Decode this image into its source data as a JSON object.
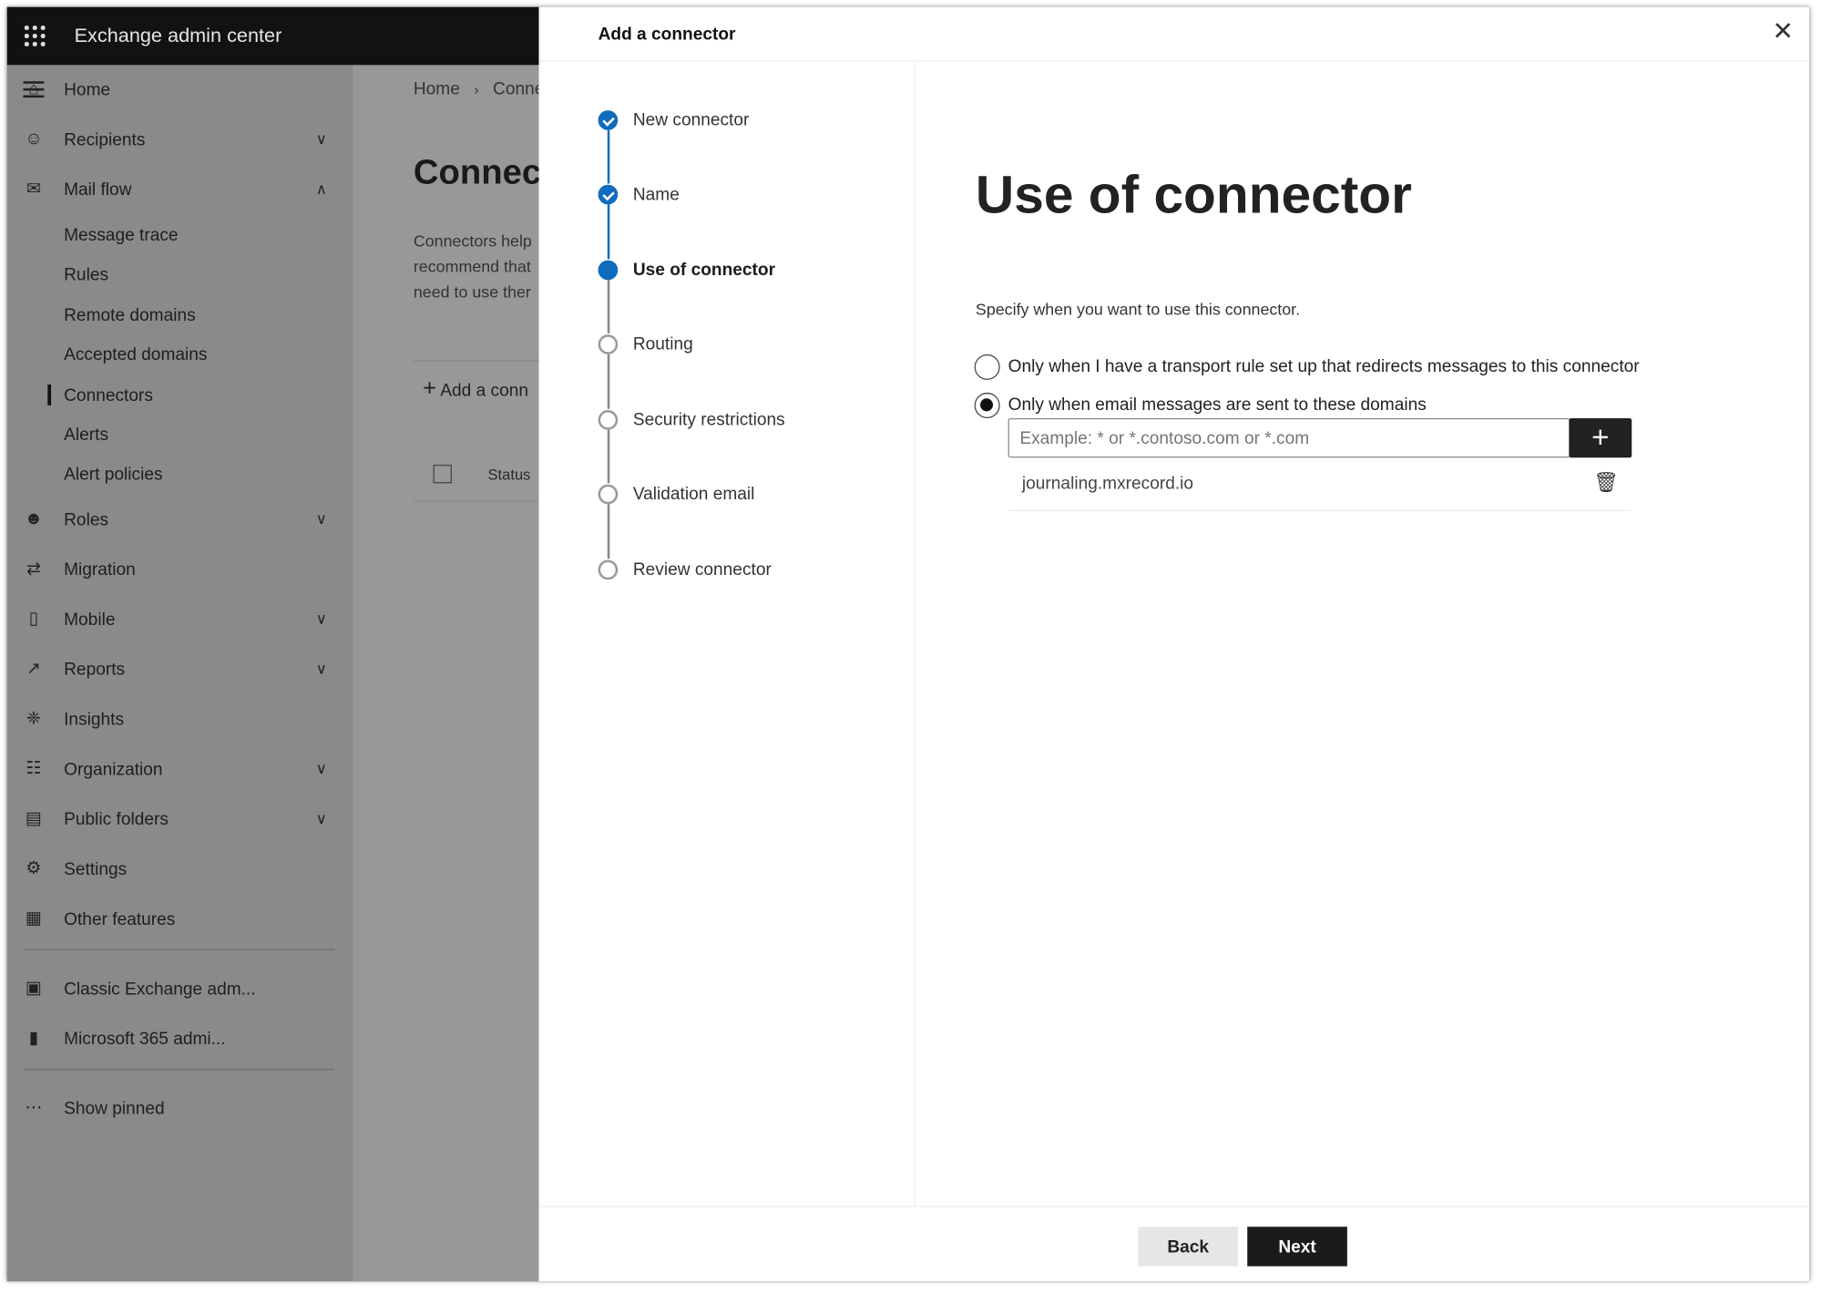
{
  "app": {
    "title": "Exchange admin center"
  },
  "sidebar": {
    "items": [
      {
        "label": "Home",
        "icon": "home-icon",
        "chevron": ""
      },
      {
        "label": "Recipients",
        "icon": "person-icon",
        "chevron": "down"
      },
      {
        "label": "Mail flow",
        "icon": "mail-icon",
        "chevron": "up"
      },
      {
        "label": "Message trace",
        "sub": true
      },
      {
        "label": "Rules",
        "sub": true
      },
      {
        "label": "Remote domains",
        "sub": true
      },
      {
        "label": "Accepted domains",
        "sub": true
      },
      {
        "label": "Connectors",
        "sub": true,
        "selected": true
      },
      {
        "label": "Alerts",
        "sub": true
      },
      {
        "label": "Alert policies",
        "sub": true
      },
      {
        "label": "Roles",
        "icon": "roles-icon",
        "chevron": "down"
      },
      {
        "label": "Migration",
        "icon": "migration-icon",
        "chevron": ""
      },
      {
        "label": "Mobile",
        "icon": "mobile-icon",
        "chevron": "down"
      },
      {
        "label": "Reports",
        "icon": "chart-icon",
        "chevron": "down"
      },
      {
        "label": "Insights",
        "icon": "lightbulb-icon",
        "chevron": ""
      },
      {
        "label": "Organization",
        "icon": "org-icon",
        "chevron": "down"
      },
      {
        "label": "Public folders",
        "icon": "folder-icon",
        "chevron": "down"
      },
      {
        "label": "Settings",
        "icon": "gear-icon",
        "chevron": ""
      },
      {
        "label": "Other features",
        "icon": "grid-icon",
        "chevron": ""
      }
    ],
    "pinned": [
      {
        "label": "Classic Exchange adm...",
        "icon": "exchange-icon"
      },
      {
        "label": "Microsoft 365 admi...",
        "icon": "office-icon"
      }
    ],
    "show_pinned": "Show pinned"
  },
  "background_page": {
    "breadcrumb": [
      "Home",
      "Conne"
    ],
    "title": "Connec",
    "desc": [
      "Connectors help",
      "recommend that",
      "need to use ther"
    ],
    "add_button": "Add a conn",
    "column_status": "Status"
  },
  "panel": {
    "title": "Add a connector",
    "steps": [
      {
        "label": "New connector",
        "state": "done"
      },
      {
        "label": "Name",
        "state": "done"
      },
      {
        "label": "Use of connector",
        "state": "current"
      },
      {
        "label": "Routing",
        "state": "pending"
      },
      {
        "label": "Security restrictions",
        "state": "pending"
      },
      {
        "label": "Validation email",
        "state": "pending"
      },
      {
        "label": "Review connector",
        "state": "pending"
      }
    ],
    "heading": "Use of connector",
    "instruction": "Specify when you want to use this connector.",
    "options": [
      {
        "label": "Only when I have a transport rule set up that redirects messages to this connector",
        "selected": false
      },
      {
        "label": "Only when email messages are sent to these domains",
        "selected": true
      }
    ],
    "domain_input": {
      "value": "",
      "placeholder": "Example: * or *.contoso.com or *.com"
    },
    "domains": [
      "journaling.mxrecord.io"
    ],
    "back": "Back",
    "next": "Next"
  },
  "colors": {
    "accent": "#0f6cbd",
    "header": "#121212"
  }
}
